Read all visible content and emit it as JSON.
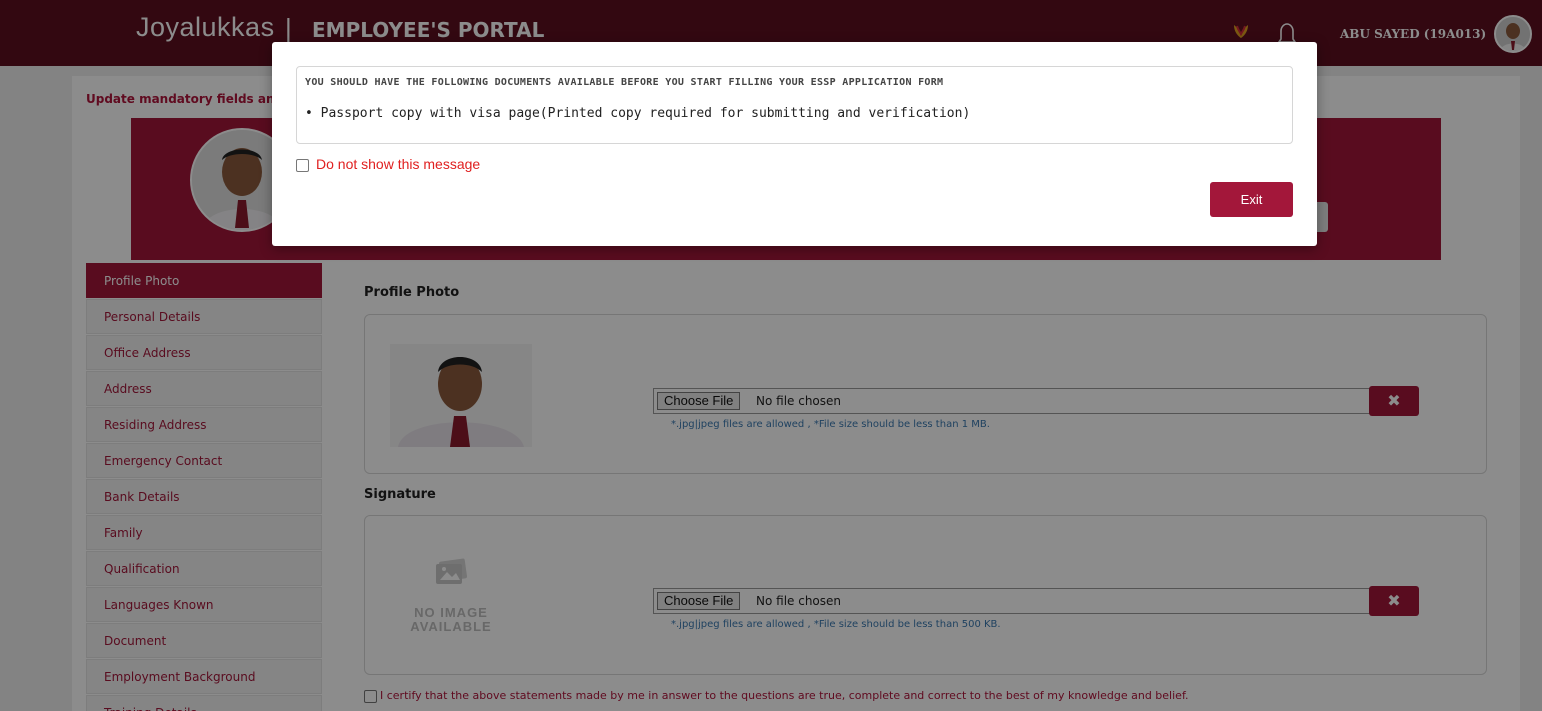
{
  "header": {
    "logo": "Joyalukkas",
    "separator": "|",
    "portal_title": "EMPLOYEE'S PORTAL",
    "user_name": "ABU SAYED (19A013)"
  },
  "banner": {
    "update_message": "Update mandatory fields and"
  },
  "sidebar": {
    "items": [
      {
        "label": "Profile Photo",
        "active": true
      },
      {
        "label": "Personal Details"
      },
      {
        "label": "Office Address"
      },
      {
        "label": "Address"
      },
      {
        "label": "Residing Address"
      },
      {
        "label": "Emergency Contact"
      },
      {
        "label": "Bank Details"
      },
      {
        "label": "Family"
      },
      {
        "label": "Qualification"
      },
      {
        "label": "Languages Known"
      },
      {
        "label": "Document"
      },
      {
        "label": "Employment Background"
      },
      {
        "label": "Training Details"
      }
    ]
  },
  "main": {
    "profile_section_title": "Profile Photo",
    "signature_section_title": "Signature",
    "profile_upload": {
      "button": "Choose File",
      "status": "No file chosen",
      "hint": "*.jpg|jpeg files are allowed , *File size should be less than 1 MB."
    },
    "signature_upload": {
      "button": "Choose File",
      "status": "No file chosen",
      "hint": "*.jpg|jpeg files are allowed , *File size should be less than 500 KB."
    },
    "no_image_line1": "NO IMAGE",
    "no_image_line2": "AVAILABLE",
    "remove_icon": "✖",
    "certify_text": "I certify that the above statements made by me in answer to the questions are true, complete and correct to the best of my knowledge and belief."
  },
  "modal": {
    "heading": "YOU SHOULD HAVE THE FOLLOWING DOCUMENTS AVAILABLE BEFORE YOU START FILLING YOUR ESSP APPLICATION FORM",
    "items": [
      "Passport copy with visa page(Printed copy required for submitting and verification)"
    ],
    "dont_show_label": "Do not show this message",
    "exit_label": "Exit"
  },
  "colors": {
    "header_bg": "#5e1020",
    "accent": "#a3173a",
    "warning_text": "#e02020",
    "hint_text": "#3a78b0"
  }
}
